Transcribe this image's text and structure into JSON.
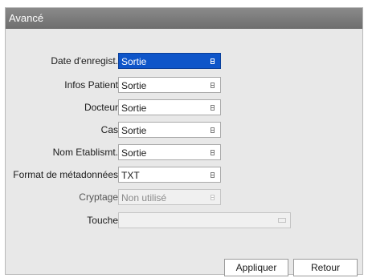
{
  "window": {
    "title": "Avancé"
  },
  "fields": [
    {
      "label": "Date d'enregist.",
      "value": "Sortie",
      "state": "selected"
    },
    {
      "label": "Infos Patient",
      "value": "Sortie",
      "state": "normal"
    },
    {
      "label": "Docteur",
      "value": "Sortie",
      "state": "normal"
    },
    {
      "label": "Cas",
      "value": "Sortie",
      "state": "normal"
    },
    {
      "label": "Nom Etablismt.",
      "value": "Sortie",
      "state": "normal"
    },
    {
      "label": "Format de métadonnées",
      "value": "TXT",
      "state": "normal"
    },
    {
      "label": "Cryptage",
      "value": "Non utilisé",
      "state": "disabled"
    }
  ],
  "key_field": {
    "label": "Touche",
    "value": ""
  },
  "buttons": {
    "apply": "Appliquer",
    "back": "Retour"
  },
  "colors": {
    "title_bar": "#7a7a7a",
    "selected_field": "#0e55c9",
    "dialog_background": "#e8e8e8"
  }
}
